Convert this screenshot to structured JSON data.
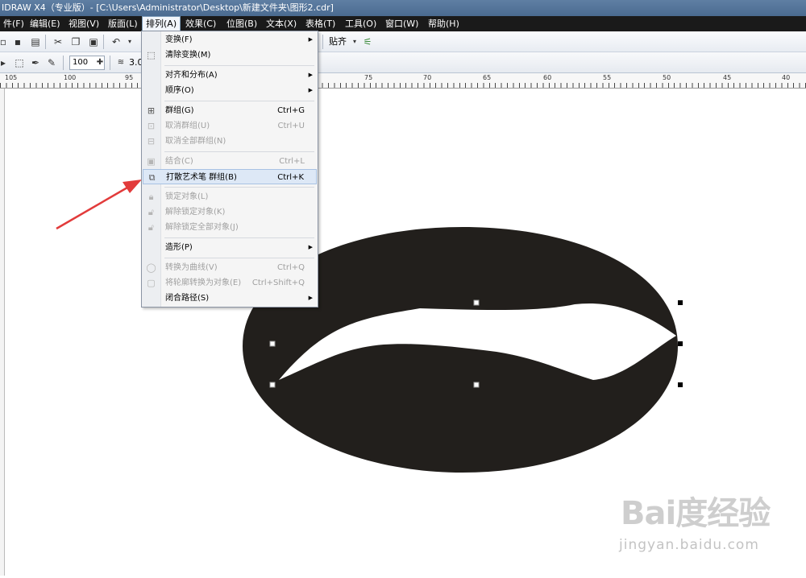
{
  "window": {
    "title": "IDRAW X4（专业版）- [C:\\Users\\Administrator\\Desktop\\新建文件夹\\图形2.cdr]"
  },
  "menubar": {
    "items": [
      "件(F)",
      "编辑(E)",
      "视图(V)",
      "版面(L)",
      "排列(A)",
      "效果(C)",
      "位图(B)",
      "文本(X)",
      "表格(T)",
      "工具(O)",
      "窗口(W)",
      "帮助(H)"
    ],
    "active_index": 4
  },
  "toolbar": {
    "snap_label": "贴齐",
    "zoom_value": "100",
    "outline_value": "3.0"
  },
  "ruler": {
    "labels": [
      "105",
      "100",
      "95",
      "75",
      "70",
      "65",
      "60",
      "55",
      "50",
      "45",
      "40"
    ]
  },
  "arrange_menu": {
    "items": [
      {
        "label": "变换(F)",
        "shortcut": "",
        "submenu": true,
        "enabled": true,
        "icon": ""
      },
      {
        "label": "清除变换(M)",
        "shortcut": "",
        "submenu": false,
        "enabled": true,
        "icon": "clear-transform-icon"
      },
      {
        "label": "对齐和分布(A)",
        "shortcut": "",
        "submenu": true,
        "enabled": true,
        "icon": ""
      },
      {
        "label": "顺序(O)",
        "shortcut": "",
        "submenu": true,
        "enabled": true,
        "icon": ""
      },
      {
        "label": "群组(G)",
        "shortcut": "Ctrl+G",
        "submenu": false,
        "enabled": true,
        "icon": "group-icon"
      },
      {
        "label": "取消群组(U)",
        "shortcut": "Ctrl+U",
        "submenu": false,
        "enabled": false,
        "icon": "ungroup-icon"
      },
      {
        "label": "取消全部群组(N)",
        "shortcut": "",
        "submenu": false,
        "enabled": false,
        "icon": "ungroup-all-icon"
      },
      {
        "label": "结合(C)",
        "shortcut": "Ctrl+L",
        "submenu": false,
        "enabled": false,
        "icon": "combine-icon"
      },
      {
        "label": "打散艺术笔 群组(B)",
        "shortcut": "Ctrl+K",
        "submenu": false,
        "enabled": true,
        "icon": "break-apart-icon",
        "highlighted": true
      },
      {
        "label": "锁定对象(L)",
        "shortcut": "",
        "submenu": false,
        "enabled": false,
        "icon": "lock-icon"
      },
      {
        "label": "解除锁定对象(K)",
        "shortcut": "",
        "submenu": false,
        "enabled": false,
        "icon": "unlock-icon"
      },
      {
        "label": "解除锁定全部对象(J)",
        "shortcut": "",
        "submenu": false,
        "enabled": false,
        "icon": "unlock-all-icon"
      },
      {
        "label": "造形(P)",
        "shortcut": "",
        "submenu": true,
        "enabled": true,
        "icon": ""
      },
      {
        "label": "转换为曲线(V)",
        "shortcut": "Ctrl+Q",
        "submenu": false,
        "enabled": false,
        "icon": "convert-curve-icon"
      },
      {
        "label": "将轮廓转换为对象(E)",
        "shortcut": "Ctrl+Shift+Q",
        "submenu": false,
        "enabled": false,
        "icon": "outline-to-object-icon"
      },
      {
        "label": "闭合路径(S)",
        "shortcut": "",
        "submenu": true,
        "enabled": true,
        "icon": ""
      }
    ]
  },
  "watermark": {
    "logo": "Bai度经验",
    "url": "jingyan.baidu.com"
  },
  "colors": {
    "shape_fill": "#221f1c",
    "arrow": "#e23b3b",
    "menu_highlight": "#dde8f6"
  }
}
